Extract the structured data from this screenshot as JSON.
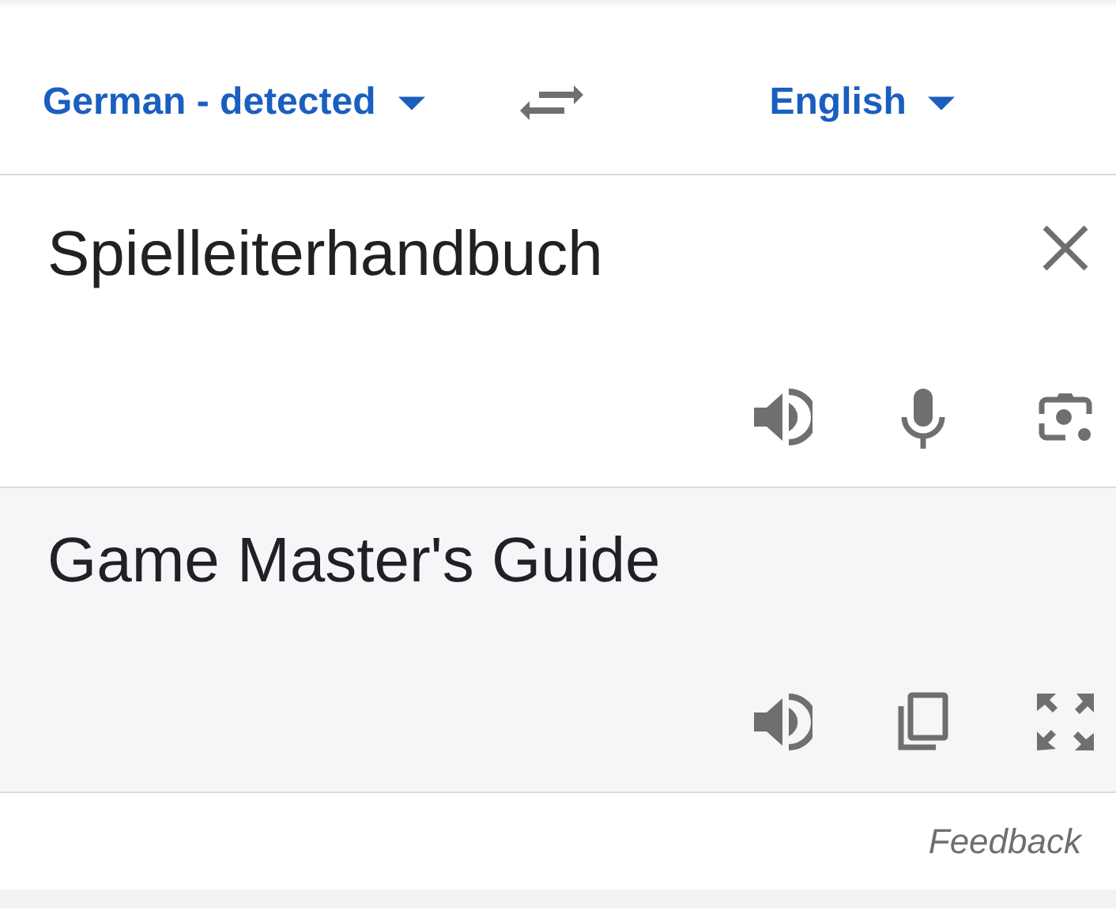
{
  "languages": {
    "source": "German - detected",
    "target": "English"
  },
  "input": {
    "text": "Spielleiterhandbuch"
  },
  "output": {
    "text": "Game Master's Guide"
  },
  "footer": {
    "link": "Feedback"
  }
}
